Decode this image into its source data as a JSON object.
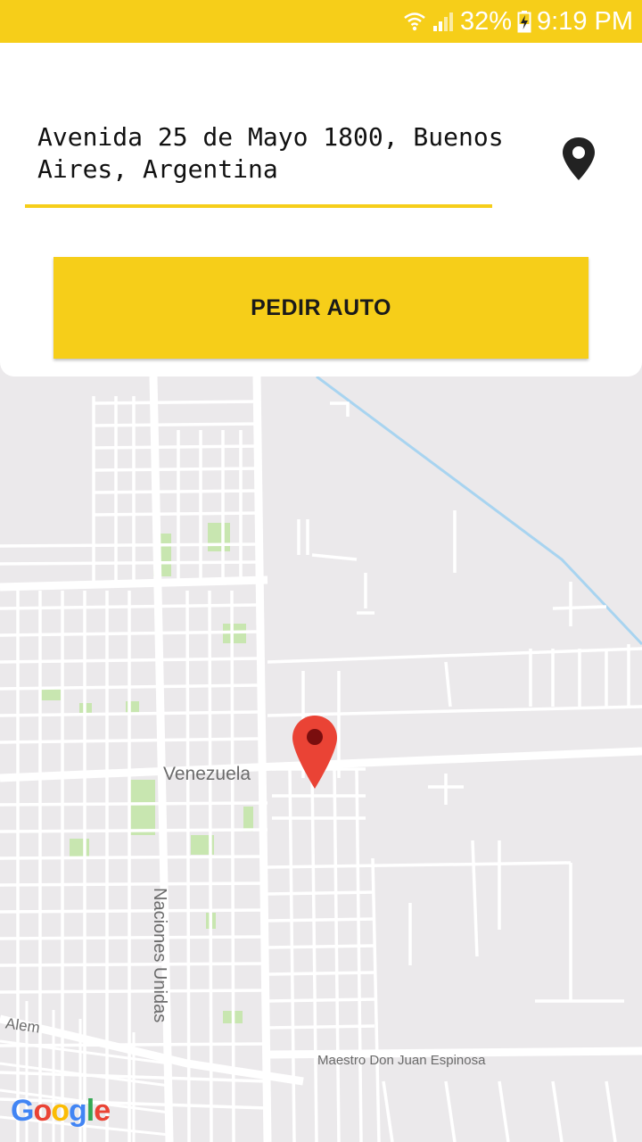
{
  "status_bar": {
    "battery": "32%",
    "time": "9:19 PM"
  },
  "address_input": {
    "value": "Avenida 25 de Mayo 1800, Buenos Aires, Argentina"
  },
  "order_button": {
    "label": "PEDIR AUTO"
  },
  "map": {
    "street_labels": {
      "venezuela": "Venezuela",
      "naciones_unidas": "Naciones Unidas",
      "alem": "Alem",
      "maestro": "Maestro Don Juan Espinosa"
    },
    "logo": [
      "G",
      "o",
      "o",
      "g",
      "l",
      "e"
    ]
  },
  "colors": {
    "accent": "#f6ce19",
    "marker": "#ea4335",
    "map_background": "#ebe9eb",
    "park": "#c8e6b0",
    "water": "#a8d4f0"
  },
  "icons": {
    "location_pin": "location-pin-icon",
    "map_marker": "map-marker-icon",
    "wifi": "wifi-icon",
    "signal": "signal-icon",
    "battery": "battery-charging-icon"
  }
}
